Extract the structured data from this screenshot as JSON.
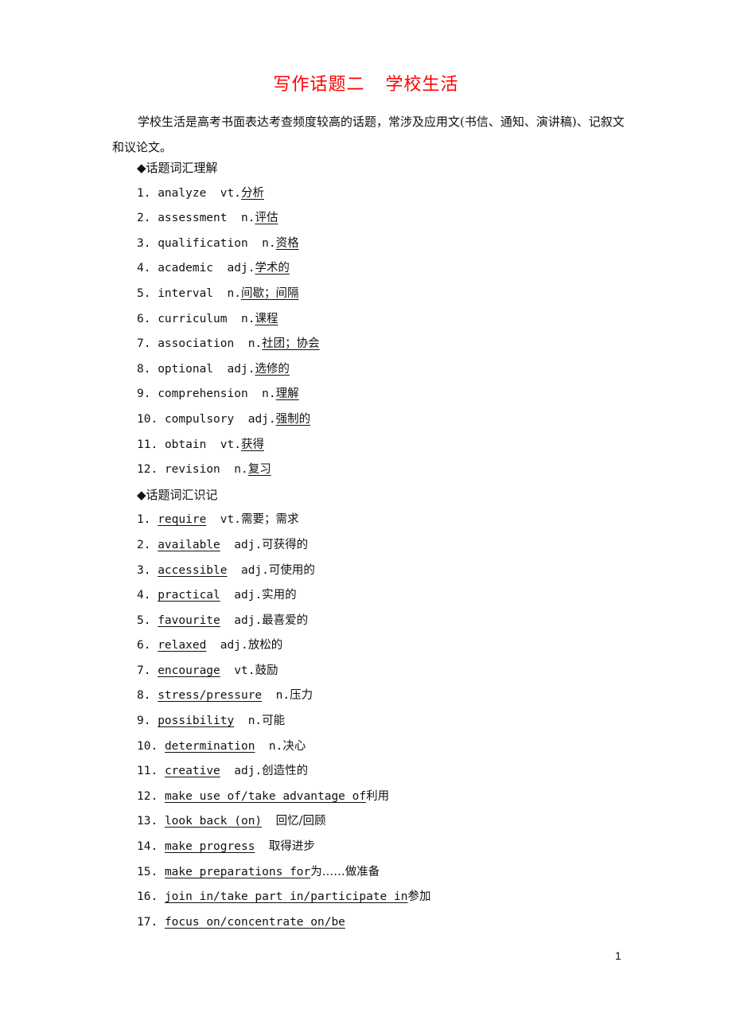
{
  "title": {
    "part1": "写作话题二",
    "part2": "学校生活"
  },
  "intro": "学校生活是高考书面表达考查频度较高的话题，常涉及应用文(书信、通知、演讲稿)、记叙文和议论文。",
  "section1": {
    "heading": "◆话题词汇理解",
    "items": [
      {
        "num": "1.",
        "word": "analyze",
        "pos": "vt.",
        "meaning": "分析"
      },
      {
        "num": "2.",
        "word": "assessment",
        "pos": "n.",
        "meaning": "评估"
      },
      {
        "num": "3.",
        "word": "qualification",
        "pos": "n.",
        "meaning": "资格"
      },
      {
        "num": "4.",
        "word": "academic",
        "pos": "adj.",
        "meaning": "学术的"
      },
      {
        "num": "5.",
        "word": "interval",
        "pos": "n.",
        "meaning": "间歇；间隔"
      },
      {
        "num": "6.",
        "word": "curriculum",
        "pos": "n.",
        "meaning": "课程"
      },
      {
        "num": "7.",
        "word": "association",
        "pos": "n.",
        "meaning": "社团；协会"
      },
      {
        "num": "8.",
        "word": "optional",
        "pos": "adj.",
        "meaning": "选修的"
      },
      {
        "num": "9.",
        "word": "comprehension",
        "pos": "n.",
        "meaning": "理解"
      },
      {
        "num": "10.",
        "word": "compulsory",
        "pos": "adj.",
        "meaning": "强制的"
      },
      {
        "num": "11.",
        "word": "obtain",
        "pos": "vt.",
        "meaning": "获得"
      },
      {
        "num": "12.",
        "word": "revision",
        "pos": "n.",
        "meaning": "复习"
      }
    ]
  },
  "section2": {
    "heading": "◆话题词汇识记",
    "items": [
      {
        "num": "1.",
        "word": "require",
        "pos": "vt.",
        "meaning": "需要；需求"
      },
      {
        "num": "2.",
        "word": "available",
        "pos": "adj.",
        "meaning": "可获得的"
      },
      {
        "num": "3.",
        "word": "accessible",
        "pos": "adj.",
        "meaning": "可使用的"
      },
      {
        "num": "4.",
        "word": "practical",
        "pos": "adj.",
        "meaning": "实用的"
      },
      {
        "num": "5.",
        "word": "favourite",
        "pos": "adj.",
        "meaning": "最喜爱的"
      },
      {
        "num": "6.",
        "word": "relaxed",
        "pos": "adj.",
        "meaning": "放松的"
      },
      {
        "num": "7.",
        "word": "encourage",
        "pos": "vt.",
        "meaning": "鼓励"
      },
      {
        "num": "8.",
        "word": "stress/pressure",
        "pos": "n.",
        "meaning": "压力"
      },
      {
        "num": "9.",
        "word": "possibility",
        "pos": "n.",
        "meaning": "可能"
      },
      {
        "num": "10.",
        "word": "determination",
        "pos": "n.",
        "meaning": "决心"
      },
      {
        "num": "11.",
        "word": "creative",
        "pos": "adj.",
        "meaning": "创造性的"
      },
      {
        "num": "12.",
        "word": "make use of/take advantage of",
        "pos": "",
        "meaning": "利用"
      },
      {
        "num": "13.",
        "word": "look back (on)",
        "pos": "",
        "meaning": "回忆/回顾"
      },
      {
        "num": "14.",
        "word": "make progress",
        "pos": "",
        "meaning": "取得进步"
      },
      {
        "num": "15.",
        "word": "make preparations for",
        "pos": "",
        "meaning": "为……做准备"
      },
      {
        "num": "16.",
        "word": "join in/take part in/participate in",
        "pos": "",
        "meaning": "参加"
      },
      {
        "num": "17.",
        "word": "focus on/concentrate on/be",
        "pos": "",
        "meaning": ""
      }
    ]
  },
  "page_number": "1",
  "colors": {
    "title": "#ff0000",
    "text": "#111111"
  }
}
